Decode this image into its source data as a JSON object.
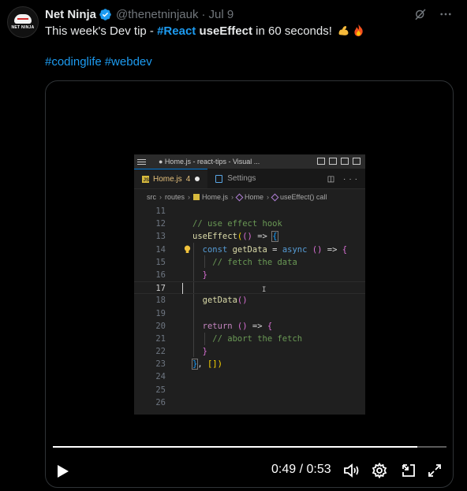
{
  "colors": {
    "background": "#000000",
    "accent": "#1d9bf0",
    "text": "#e7e9ea",
    "muted": "#71767b"
  },
  "tweet": {
    "avatar_text": "NET NINJA",
    "author_name": "Net Ninja",
    "verified_icon": "verified-badge-icon",
    "handle": "@thenetninjauk",
    "separator": "·",
    "date": "Jul 9",
    "text_prefix": "This week's Dev tip - ",
    "hashtag_react": "#React",
    "text_bold": "useEffect",
    "text_suffix": " in 60 seconds!",
    "emojis": [
      "flexed-biceps-emoji",
      "fire-emoji"
    ],
    "hashtags": [
      "#codinglife",
      "#webdev"
    ],
    "top_icons": [
      "grok-icon",
      "more-icon"
    ]
  },
  "editor": {
    "window_title": "● Home.js - react-tips - Visual ...",
    "tabs": [
      {
        "label": "Home.js",
        "badge": "JS",
        "modified": "4",
        "active": true
      },
      {
        "label": "Settings",
        "active": false
      }
    ],
    "tab_actions": "◫ ···",
    "breadcrumb": [
      "src",
      "routes",
      "Home.js",
      "Home",
      "useEffect() call"
    ],
    "lines": [
      {
        "num": "11"
      },
      {
        "num": "12"
      },
      {
        "num": "13"
      },
      {
        "num": "14"
      },
      {
        "num": "15"
      },
      {
        "num": "16"
      },
      {
        "num": "17"
      },
      {
        "num": "18"
      },
      {
        "num": "19"
      },
      {
        "num": "20"
      },
      {
        "num": "21"
      },
      {
        "num": "22"
      },
      {
        "num": "23"
      },
      {
        "num": "24"
      },
      {
        "num": "25"
      },
      {
        "num": "26"
      }
    ],
    "code": {
      "l12": "// use effect hook",
      "l13_fn": "useEffect",
      "l14_kw": "const",
      "l14_var": "getData",
      "l14_async": "async",
      "l15": "// fetch the data",
      "l18_fn": "getData",
      "l20_kw": "return",
      "l21": "// abort the fetch"
    }
  },
  "player": {
    "current_time": "0:49",
    "duration": "0:53",
    "time_sep": " / ",
    "progress": 0.925,
    "controls": [
      "play-icon",
      "volume-icon",
      "settings-icon",
      "pip-icon",
      "fullscreen-icon"
    ]
  }
}
